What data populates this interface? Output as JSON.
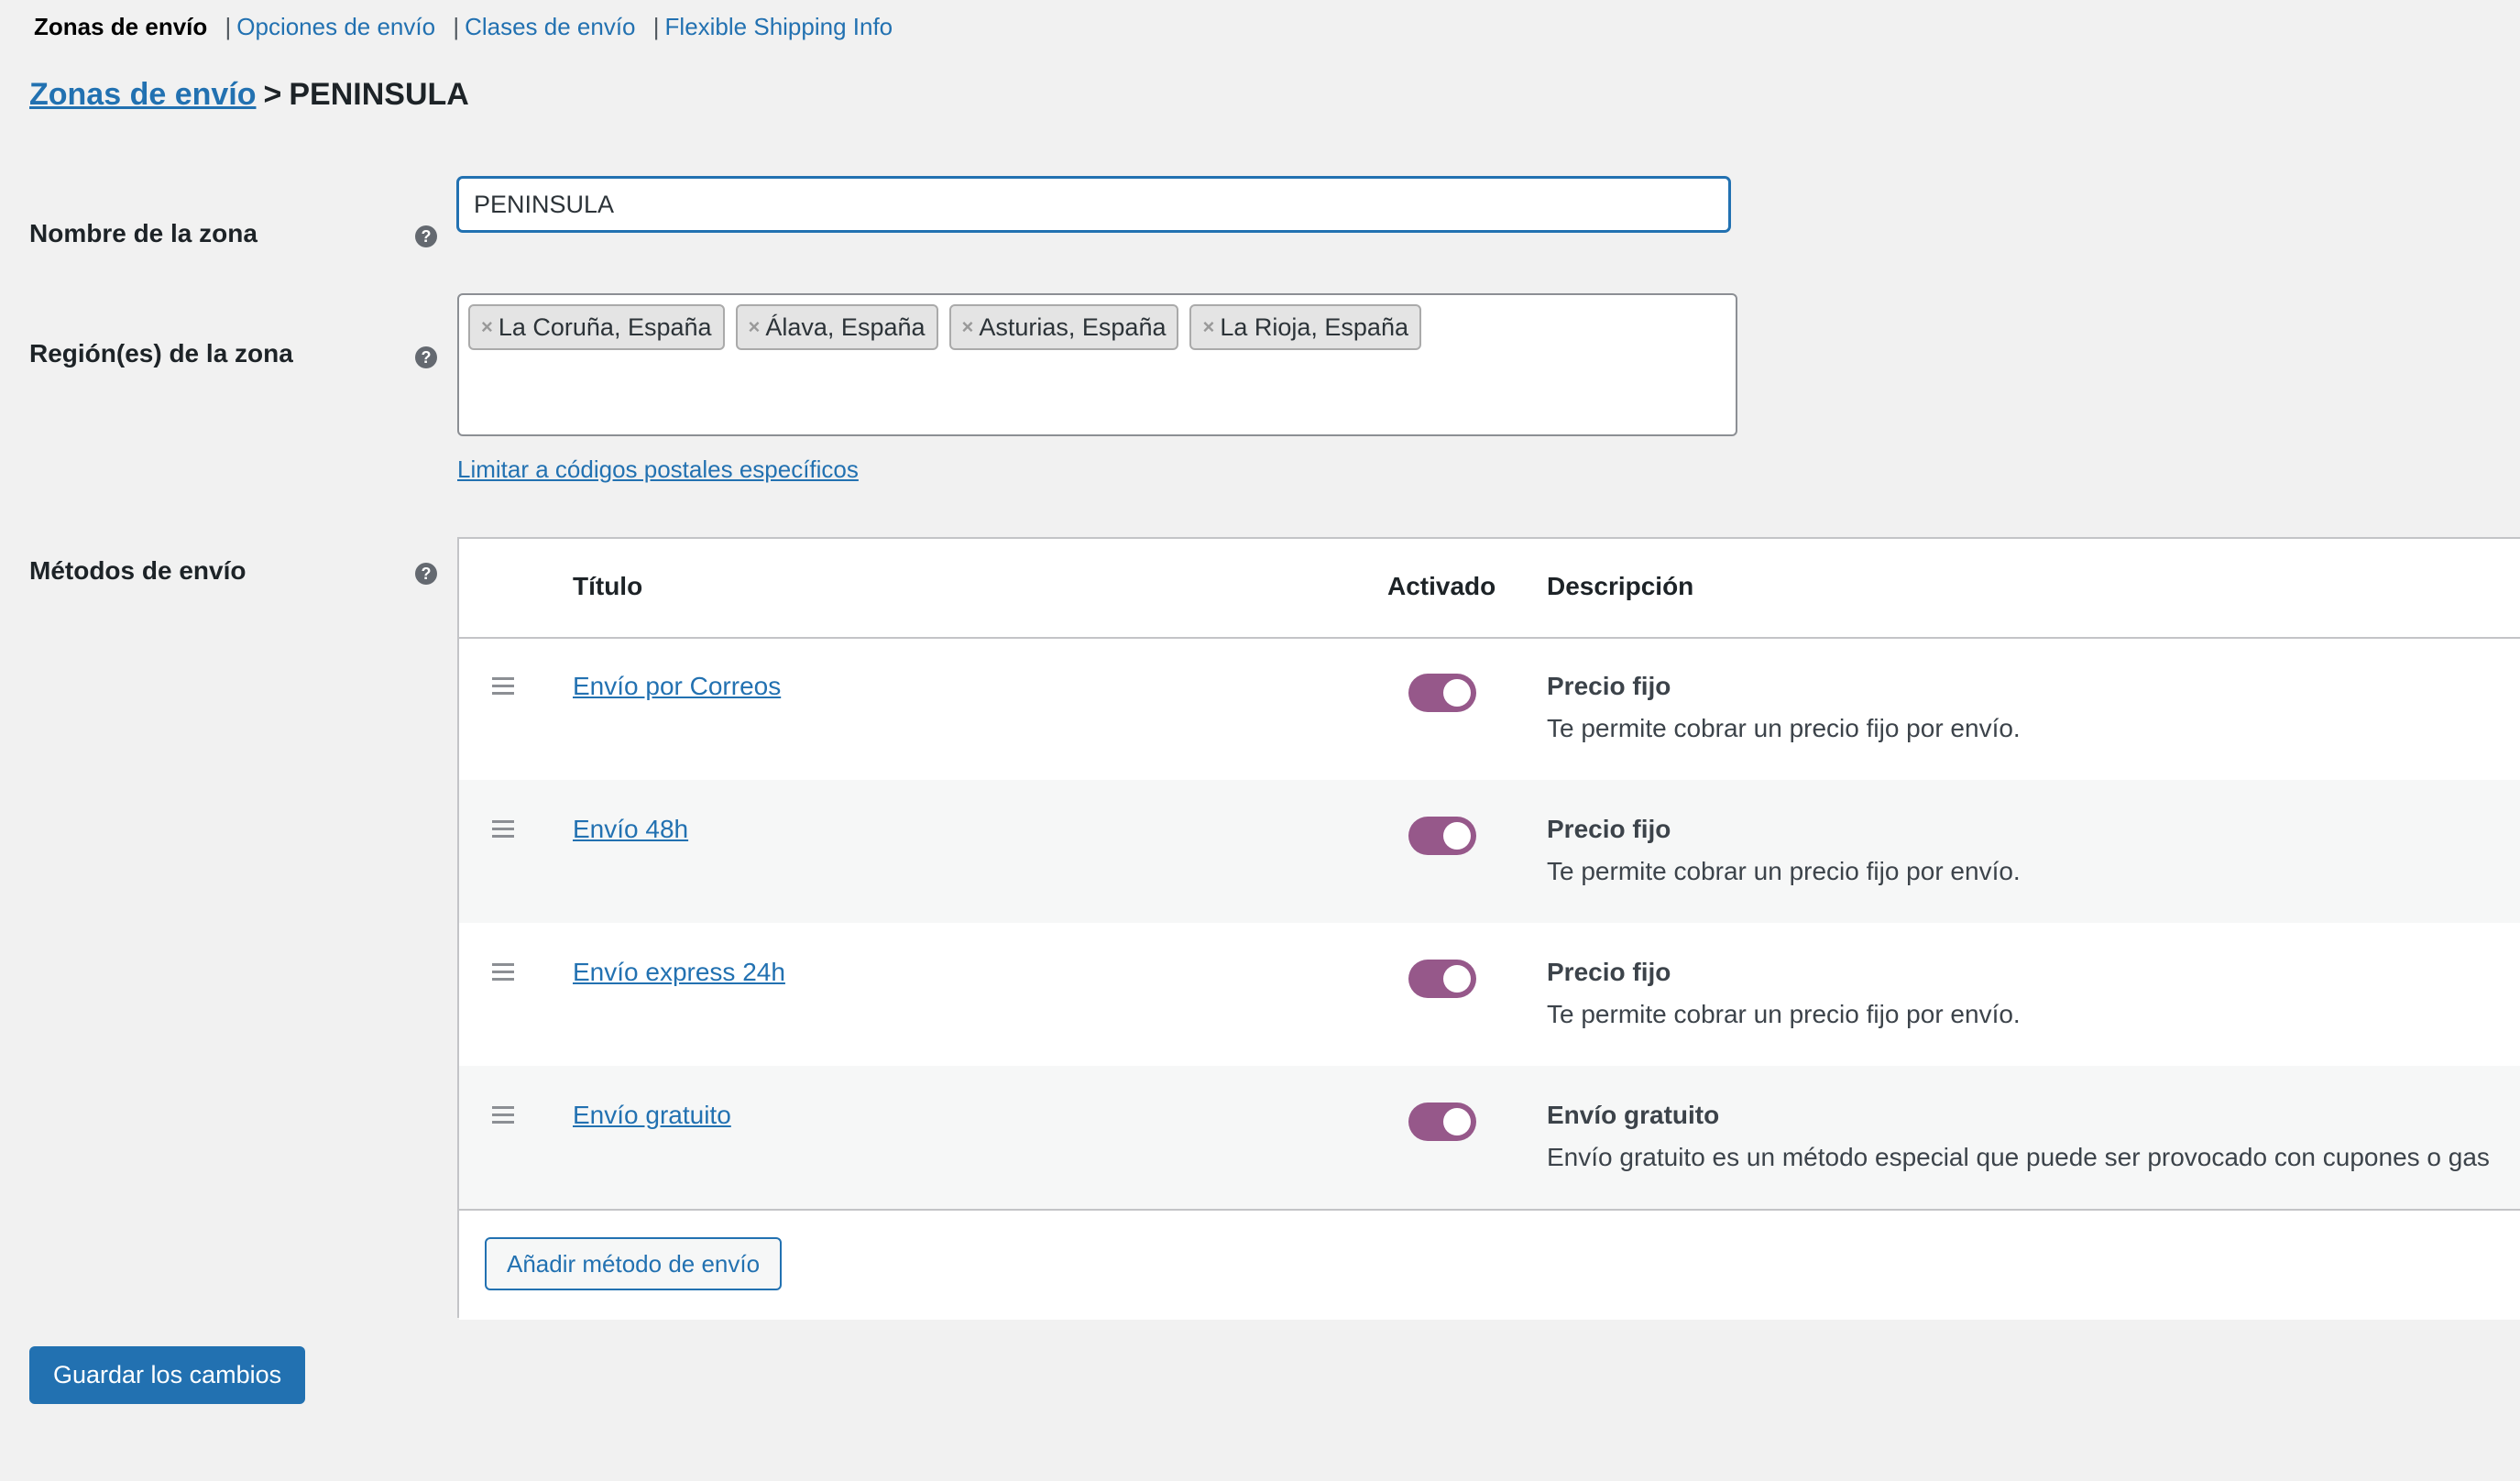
{
  "nav": {
    "current": "Zonas de envío",
    "links": [
      "Opciones de envío",
      "Clases de envío",
      "Flexible Shipping Info"
    ],
    "separator": "|"
  },
  "breadcrumb": {
    "parent": "Zonas de envío",
    "arrow": ">",
    "current": "PENINSULA"
  },
  "zone_name": {
    "label": "Nombre de la zona",
    "value": "PENINSULA"
  },
  "regions": {
    "label": "Región(es) de la zona",
    "remove_symbol": "×",
    "items": [
      "La Coruña, España",
      "Álava, España",
      "Asturias, España",
      "La Rioja, España"
    ],
    "postcode_link": "Limitar a códigos postales específicos"
  },
  "methods": {
    "label": "Métodos de envío",
    "headers": {
      "title": "Título",
      "enabled": "Activado",
      "description": "Descripción"
    },
    "rows": [
      {
        "title": "Envío por Correos",
        "desc_title": "Precio fijo",
        "desc": "Te permite cobrar un precio fijo por envío."
      },
      {
        "title": "Envío 48h",
        "desc_title": "Precio fijo",
        "desc": "Te permite cobrar un precio fijo por envío."
      },
      {
        "title": "Envío express 24h",
        "desc_title": "Precio fijo",
        "desc": "Te permite cobrar un precio fijo por envío."
      },
      {
        "title": "Envío gratuito",
        "desc_title": "Envío gratuito",
        "desc": "Envío gratuito es un método especial que puede ser provocado con cupones o gas"
      }
    ],
    "add_button": "Añadir método de envío"
  },
  "help_icon": "?",
  "save_button": "Guardar los cambios",
  "colors": {
    "accent": "#2271b1",
    "toggle_on": "#96588a"
  }
}
